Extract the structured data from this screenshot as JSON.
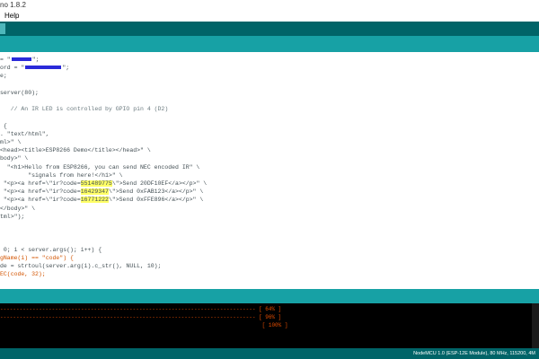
{
  "window": {
    "title": "no 1.8.2"
  },
  "menu": {
    "items": [
      "Help"
    ]
  },
  "editor": {
    "lines": [
      {
        "segments": [
          {
            "t": "= \""
          },
          {
            "t": "",
            "redact": "short"
          },
          {
            "t": "\";"
          }
        ]
      },
      {
        "segments": [
          {
            "t": "ord = \""
          },
          {
            "t": "",
            "redact": "long"
          },
          {
            "t": "\";"
          }
        ]
      },
      {
        "segments": [
          {
            "t": "e;"
          }
        ]
      },
      {
        "segments": [
          {
            "t": ""
          }
        ]
      },
      {
        "segments": [
          {
            "t": "server(80);"
          }
        ]
      },
      {
        "segments": [
          {
            "t": ""
          }
        ]
      },
      {
        "segments": [
          {
            "t": "   // An IR LED is controlled by GPIO pin 4 (D2)",
            "cls": "cm"
          }
        ]
      },
      {
        "segments": [
          {
            "t": ""
          }
        ]
      },
      {
        "segments": [
          {
            "t": " {"
          }
        ]
      },
      {
        "segments": [
          {
            "t": ". \"text/html\","
          }
        ]
      },
      {
        "segments": [
          {
            "t": "ml>\" \\"
          }
        ]
      },
      {
        "segments": [
          {
            "t": "<head><title>ESP8266 Demo</title></head>\" \\"
          }
        ]
      },
      {
        "segments": [
          {
            "t": "body>\" \\"
          }
        ]
      },
      {
        "segments": [
          {
            "t": "  \"<h1>Hello from ESP8266, you can send NEC encoded IR\" \\"
          }
        ]
      },
      {
        "segments": [
          {
            "t": "        \"signals from here!</h1>\" \\"
          }
        ]
      },
      {
        "segments": [
          {
            "t": " \"<p><a href=\\\"ir?code="
          },
          {
            "t": "551489775",
            "cls": "hl"
          },
          {
            "t": "\\\">Send 20DF10EF</a></p>\" \\"
          }
        ]
      },
      {
        "segments": [
          {
            "t": " \"<p><a href=\\\"ir?code="
          },
          {
            "t": "16429347",
            "cls": "hl"
          },
          {
            "t": "\\\">Send 0xFAB123</a></p>\" \\"
          }
        ]
      },
      {
        "segments": [
          {
            "t": " \"<p><a href=\\\"ir?code="
          },
          {
            "t": "16771222",
            "cls": "hl"
          },
          {
            "t": "\\\">Send 0xFFE896</a></p>\" \\"
          }
        ]
      },
      {
        "segments": [
          {
            "t": "</body>\" \\"
          }
        ]
      },
      {
        "segments": [
          {
            "t": "tml>\");"
          }
        ]
      },
      {
        "segments": [
          {
            "t": ""
          }
        ]
      },
      {
        "segments": [
          {
            "t": ""
          }
        ]
      },
      {
        "segments": [
          {
            "t": ""
          }
        ]
      },
      {
        "segments": [
          {
            "t": " 0; i < server.args(); i++) {"
          }
        ]
      },
      {
        "segments": [
          {
            "t": "gName(i) == \"code\") {",
            "cls": "kw"
          }
        ]
      },
      {
        "segments": [
          {
            "t": "de = strtoul(server.arg(i).c_str(), NULL, 10);"
          }
        ]
      },
      {
        "segments": [
          {
            "t": "EC(code, 32);",
            "cls": "kw"
          }
        ]
      }
    ]
  },
  "console": {
    "lines": [
      "------------------------------------------------------------------------------- [ 64% ]",
      "------------------------------------------------------------------------------- [ 96% ]",
      "                                                                                 [ 100% ]"
    ]
  },
  "status": {
    "board": "NodeMCU 1.0 (ESP-12E Module), 80 MHz, 115200, 4M"
  },
  "colors": {
    "toolbar": "#006468",
    "tabs": "#17a1a5",
    "console_text": "#e34c00",
    "highlight": "#ffff66"
  }
}
